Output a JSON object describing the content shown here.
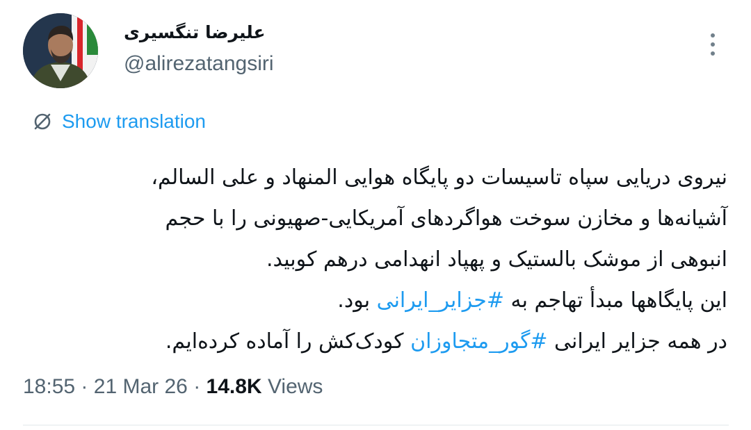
{
  "author": {
    "display_name": "علیرضا تنگسیری",
    "handle": "@alirezatangsiri",
    "avatar_icon": "profile-photo"
  },
  "more_icon": "more-vertical-icon",
  "translation": {
    "label": "Show translation",
    "icon": "translate-globe-icon"
  },
  "tweet": {
    "lines": [
      {
        "text": "نیروی دریایی سپاه تاسیسات دو پایگاه هوایی المنهاد و علی السالم،"
      },
      {
        "text": "آشیانه‌ها و مخازن سوخت هواگردهای آمریکایی-صهیونی را با حجم"
      },
      {
        "text": "انبوهی از موشک بالستیک و پهپاد انهدامی درهم کوبید."
      },
      {
        "before": "این پایگاهها مبدأ تهاجم به ",
        "hashtag": "#جزایر_ایرانی",
        "after": " بود."
      },
      {
        "before": "در همه جزایر ایرانی ",
        "hashtag": "#گور_متجاوزان",
        "after": " کودک‌کش را آماده کرده‌ایم."
      }
    ],
    "hashtag_color": "#1d9bf0",
    "text_color": "#0f1419"
  },
  "meta": {
    "time": "18:55",
    "separator": "·",
    "date": "21 Mar 26",
    "views_count": "14.8K",
    "views_label": "Views"
  },
  "colors": {
    "accent": "#1d9bf0",
    "secondary_text": "#536471",
    "divider": "#eff3f4"
  }
}
